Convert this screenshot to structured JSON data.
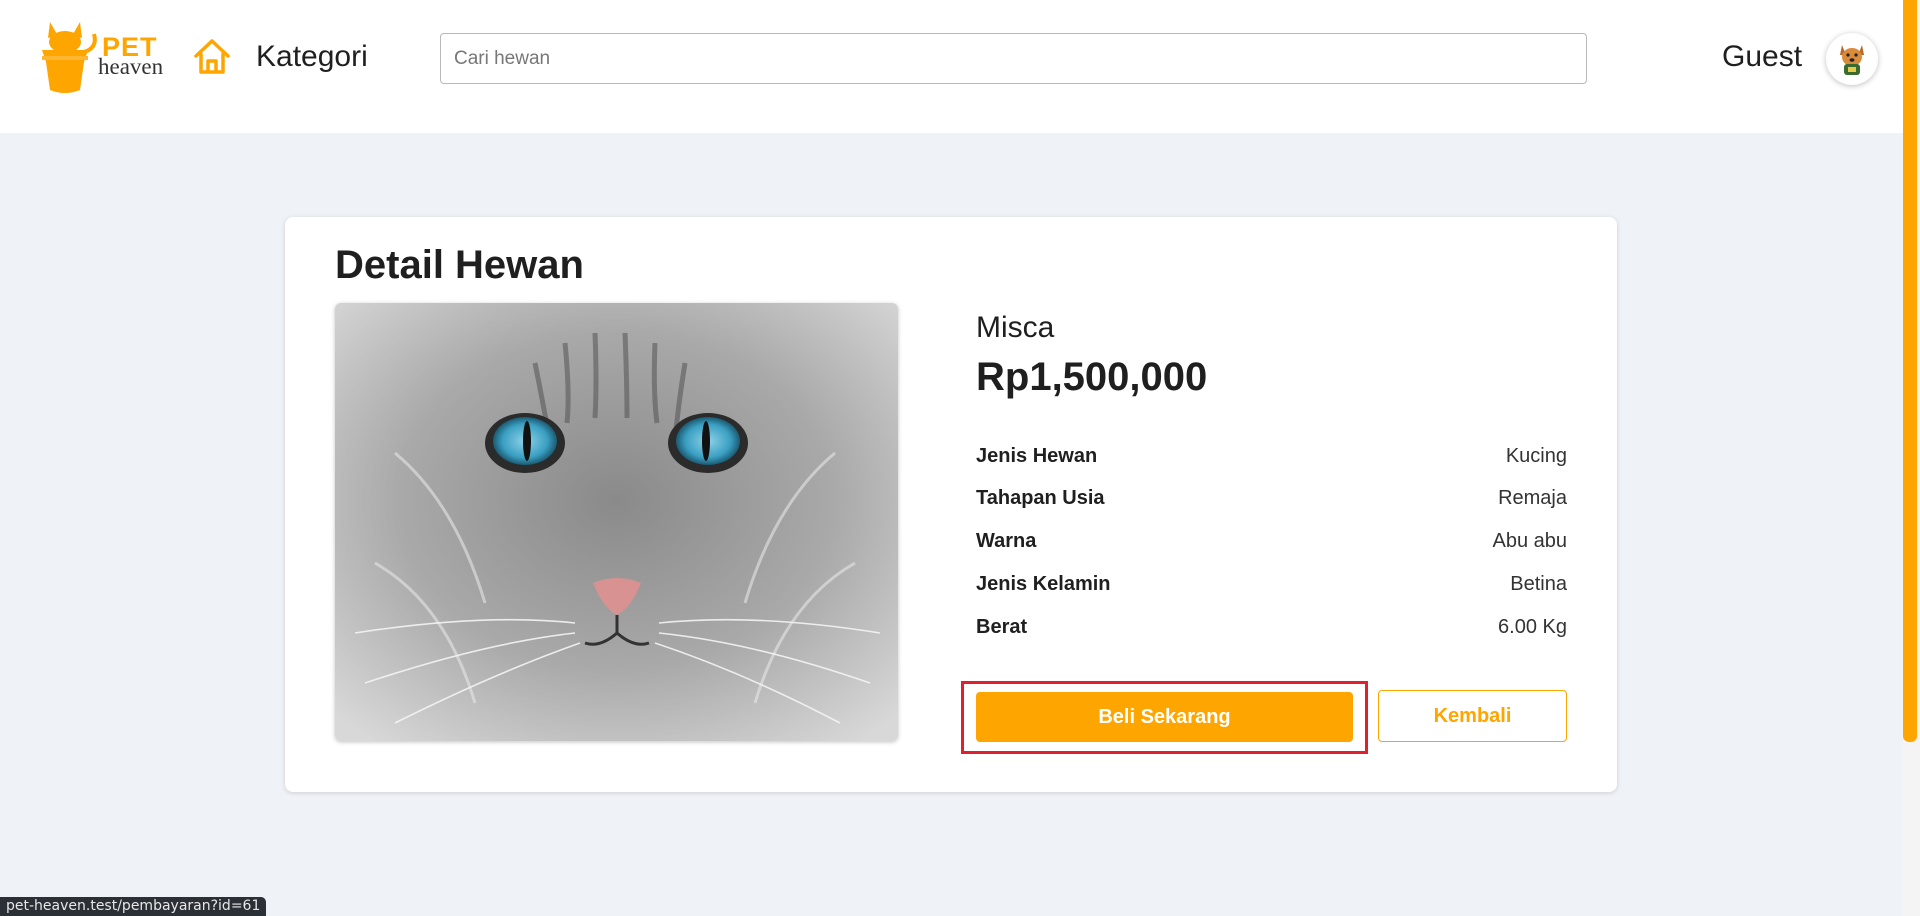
{
  "header": {
    "logo_pet": "PET",
    "logo_heaven": "heaven",
    "category_label": "Kategori",
    "search_placeholder": "Cari hewan",
    "user_label": "Guest"
  },
  "detail": {
    "title": "Detail Hewan",
    "name": "Misca",
    "price": "Rp1,500,000",
    "attributes": [
      {
        "label": "Jenis Hewan",
        "value": "Kucing"
      },
      {
        "label": "Tahapan Usia",
        "value": "Remaja"
      },
      {
        "label": "Warna",
        "value": "Abu abu"
      },
      {
        "label": "Jenis Kelamin",
        "value": "Betina"
      },
      {
        "label": "Berat",
        "value": "6.00 Kg"
      }
    ],
    "buy_label": "Beli Sekarang",
    "back_label": "Kembali"
  },
  "status": {
    "url": "pet-heaven.test/pembayaran?id=61"
  },
  "colors": {
    "accent": "#ffa500",
    "background": "#eff2f7",
    "highlight": "#e0202e"
  }
}
